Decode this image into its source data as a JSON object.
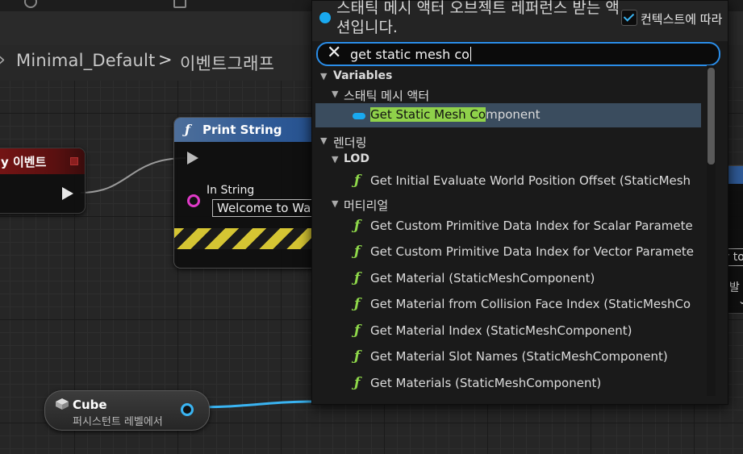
{
  "breadcrumb": {
    "items": [
      "Minimal_Default",
      "이벤트그래프"
    ],
    "separator": ">"
  },
  "event_node": {
    "title": "y 이벤트",
    "color": "#7a1515"
  },
  "print_node": {
    "title": "Print String",
    "icon": "function-icon",
    "in_string_label": "In String",
    "in_string_value": "Welcome to Wa"
  },
  "cube_node": {
    "title": "Cube",
    "subtitle": "퍼시스턴트 레벨에서"
  },
  "right_node": {
    "box_text": "y to",
    "label": "개발"
  },
  "context_menu": {
    "description": "스태틱 메시 액터 오브젝트 레퍼런스 받는 액션입니다.",
    "context_sensitive_label": "컨텍스트에 따라",
    "context_sensitive_checked": true,
    "search_value": "get static mesh co",
    "rows": [
      {
        "type": "category",
        "label": "Variables"
      },
      {
        "type": "subcategory",
        "label": "스태틱 메시 액터"
      },
      {
        "type": "variable",
        "prefix": "Get Static Mesh Co",
        "label": "mponent",
        "selected": true
      },
      {
        "type": "category",
        "label": "렌더링"
      },
      {
        "type": "subcategory",
        "label": "LOD"
      },
      {
        "type": "function",
        "label": "Get Initial Evaluate World Position Offset (StaticMesh"
      },
      {
        "type": "subcategory",
        "label": "머티리얼"
      },
      {
        "type": "function",
        "label": "Get Custom Primitive Data Index for Scalar Paramete"
      },
      {
        "type": "function",
        "label": "Get Custom Primitive Data Index for Vector Paramete"
      },
      {
        "type": "function",
        "label": "Get Material (StaticMeshComponent)"
      },
      {
        "type": "function",
        "label": "Get Material from Collision Face Index (StaticMeshCo"
      },
      {
        "type": "function",
        "label": "Get Material Index (StaticMeshComponent)"
      },
      {
        "type": "function",
        "label": "Get Material Slot Names (StaticMeshComponent)"
      },
      {
        "type": "function",
        "label": "Get Materials (StaticMeshComponent)"
      }
    ]
  },
  "colors": {
    "accent_blue": "#19a9f0",
    "function_green": "#8fd94a",
    "string_pin": "#e03ac8",
    "selection": "#3a4c5e"
  }
}
